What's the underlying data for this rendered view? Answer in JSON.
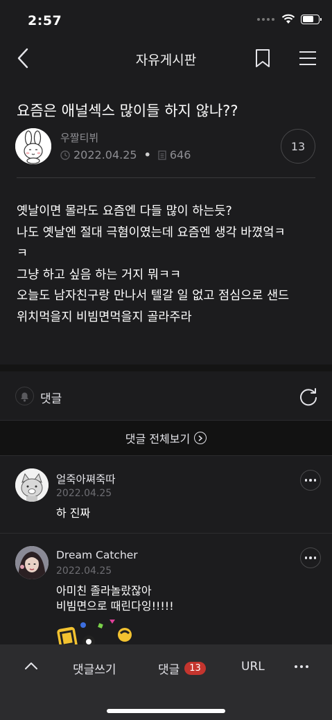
{
  "status_bar": {
    "time": "2:57"
  },
  "header": {
    "title": "자유게시판"
  },
  "post": {
    "title": "요즘은 애널섹스 많이들 하지 않나??",
    "author": "우짤티뷔",
    "date": "2022.04.25",
    "views": "646",
    "comment_count": "13",
    "body_lines": [
      "옛날이면 몰라도 요즘엔 다들 많이 하는듯?",
      "나도 옛날엔 절대 극혐이였는데 요즘엔 생각 바꼈엌ㅋ",
      "ㅋ",
      "그냥 하고 싶음 하는 거지 뭐ㅋㅋ",
      "오늘도 남자친구랑 만나서 텔갈 일 없고 점심으로 샌드",
      "위치먹을지 비빔면먹을지 골라주라"
    ]
  },
  "comments_section": {
    "label": "댓글",
    "view_all": "댓글 전체보기"
  },
  "comments": [
    {
      "name": "얼죽아쪄죽따",
      "date": "2022.04.25",
      "lines": [
        "하 진짜"
      ]
    },
    {
      "name": "Dream Catcher",
      "date": "2022.04.25",
      "lines": [
        "아미친 졸라놀랐잖아",
        "비빔면으로 때린다잉!!!!!"
      ]
    }
  ],
  "bottom_bar": {
    "write": "댓글쓰기",
    "comments": "댓글",
    "comments_badge": "13",
    "url": "URL"
  },
  "colors": {
    "background": "#1c1c1e",
    "badge": "#c4352e",
    "muted": "#8e8e93"
  }
}
